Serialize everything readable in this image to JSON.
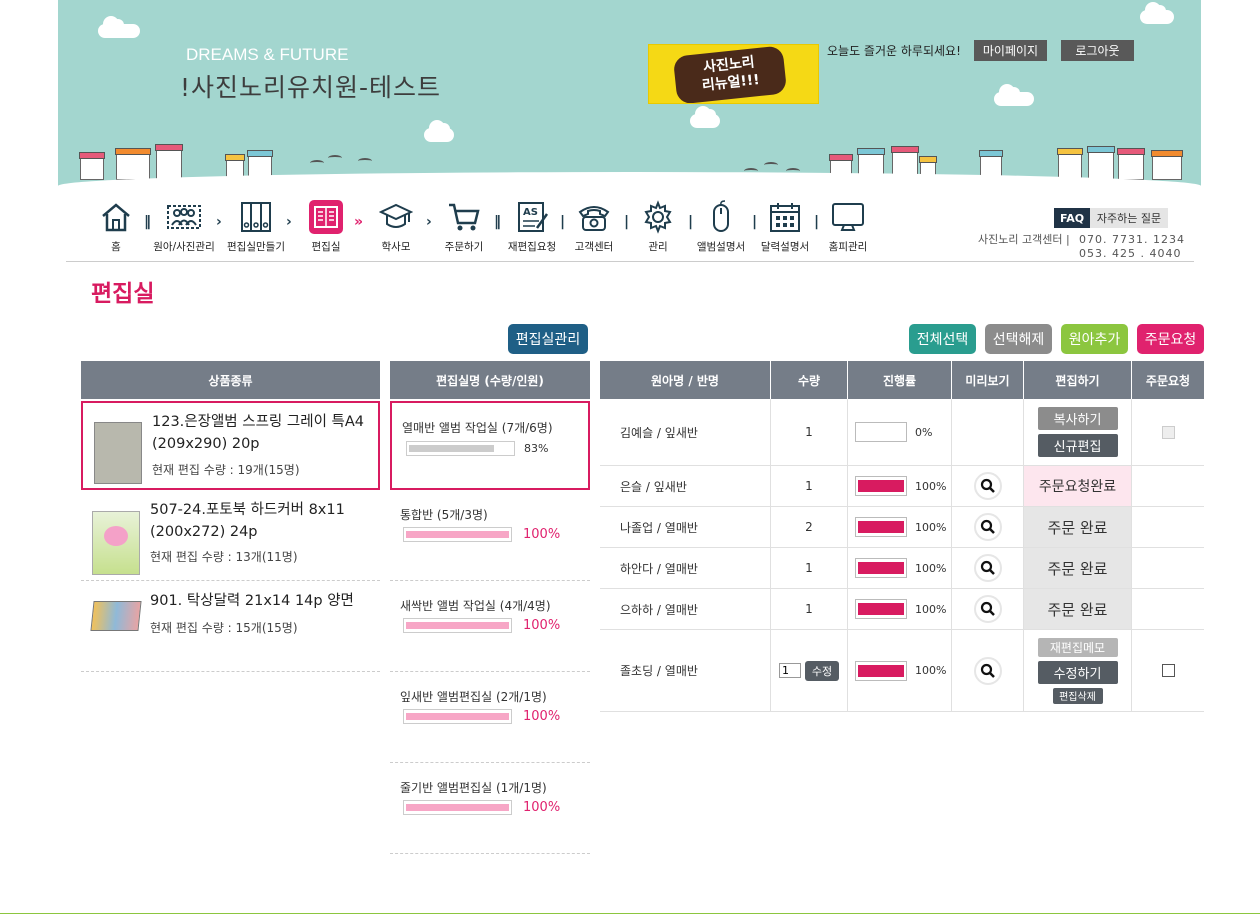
{
  "header": {
    "brand_sub": "DREAMS & FUTURE",
    "brand_title": "!사진노리유치원-테스트",
    "banner_text_1": "사진노리",
    "banner_text_2": "리뉴얼!!!",
    "greeting": "오늘도 즐거운 하루되세요!",
    "mypage_label": "마이페이지",
    "logout_label": "로그아웃"
  },
  "nav": {
    "items": [
      {
        "label": "홈",
        "icon": "home-icon"
      },
      {
        "label": "원아/사진관리",
        "icon": "people-icon"
      },
      {
        "label": "편집실만들기",
        "icon": "binders-icon"
      },
      {
        "label": "편집실",
        "icon": "book-icon"
      },
      {
        "label": "학사모",
        "icon": "graduation-cap-icon"
      },
      {
        "label": "주문하기",
        "icon": "cart-icon"
      },
      {
        "label": "재편집요청",
        "icon": "as-edit-icon"
      },
      {
        "label": "고객센터",
        "icon": "phone-icon"
      },
      {
        "label": "관리",
        "icon": "gear-icon"
      },
      {
        "label": "앨범설명서",
        "icon": "mouse-icon"
      },
      {
        "label": "달력설명서",
        "icon": "calendar-icon"
      },
      {
        "label": "홈피관리",
        "icon": "monitor-icon"
      }
    ],
    "active_index": 3,
    "active_color": "#e0226e"
  },
  "faq": {
    "badge": "FAQ",
    "label": "자주하는 질문"
  },
  "customer_center": {
    "label": "사진노리 고객센터 |",
    "phone1": "070. 7731. 1234",
    "phone2": "053. 425 . 4040"
  },
  "page_title": "편집실",
  "actions": {
    "manage_rooms": "편집실관리",
    "select_all": "전체선택",
    "deselect": "선택해제",
    "add_child": "원아추가",
    "order_request": "주문요청"
  },
  "colors": {
    "manage_rooms": "#1f5f86",
    "select_all": "#2a9d8f",
    "deselect": "#8c8c8c",
    "add_child": "#8cc63f",
    "order_request": "#e0226e",
    "accent": "#d81b60"
  },
  "products": {
    "header": "상품종류",
    "items": [
      {
        "name": "123.은장앨범 스프링 그레이 특A4 (209x290) 20p",
        "count": "현재 편집 수량 : 19개(15명)",
        "selected": true
      },
      {
        "name": "507-24.포토북 하드커버 8x11 (200x272) 24p",
        "count": "현재 편집 수량 : 13개(11명)",
        "selected": false
      },
      {
        "name": "901. 탁상달력 21x14 14p 양면",
        "count": "현재 편집 수량 : 15개(15명)",
        "selected": false
      }
    ]
  },
  "rooms": {
    "header": "편집실명 (수량/인원)",
    "items": [
      {
        "name": "열매반 앨범 작업실 (7개/6명)",
        "progress": 83,
        "progress_text": "83%"
      },
      {
        "name": "통합반 (5개/3명)",
        "progress": 100,
        "progress_text": "100%"
      },
      {
        "name": "새싹반 앨범 작업실 (4개/4명)",
        "progress": 100,
        "progress_text": "100%"
      },
      {
        "name": "잎새반 앨범편집실 (2개/1명)",
        "progress": 100,
        "progress_text": "100%"
      },
      {
        "name": "줄기반 앨범편집실 (1개/1명)",
        "progress": 100,
        "progress_text": "100%"
      }
    ]
  },
  "children": {
    "headers": [
      "원아명 / 반명",
      "수량",
      "진행률",
      "미리보기",
      "편집하기",
      "주문요청"
    ],
    "rows": [
      {
        "name": "김예슬 / 잎새반",
        "qty": "1",
        "progress": 0,
        "progress_text": "0%",
        "preview": false,
        "edit": [
          "복사하기",
          "신규편집"
        ],
        "checkbox": "disabled"
      },
      {
        "name": "은슬 / 잎새반",
        "qty": "1",
        "progress": 100,
        "progress_text": "100%",
        "preview": true,
        "status": "주문요청완료"
      },
      {
        "name": "나졸업 / 열매반",
        "qty": "2",
        "progress": 100,
        "progress_text": "100%",
        "preview": true,
        "status": "주문 완료"
      },
      {
        "name": "하안다 / 열매반",
        "qty": "1",
        "progress": 100,
        "progress_text": "100%",
        "preview": true,
        "status": "주문 완료"
      },
      {
        "name": "으하하 / 열매반",
        "qty": "1",
        "progress": 100,
        "progress_text": "100%",
        "preview": true,
        "status": "주문 완료"
      },
      {
        "name": "졸초딩 / 열매반",
        "qty": "1",
        "qty_button": "수정",
        "progress": 100,
        "progress_text": "100%",
        "preview": true,
        "edit": [
          "재편집메모",
          "수정하기",
          "편집삭제"
        ],
        "checkbox": "enabled"
      }
    ]
  }
}
